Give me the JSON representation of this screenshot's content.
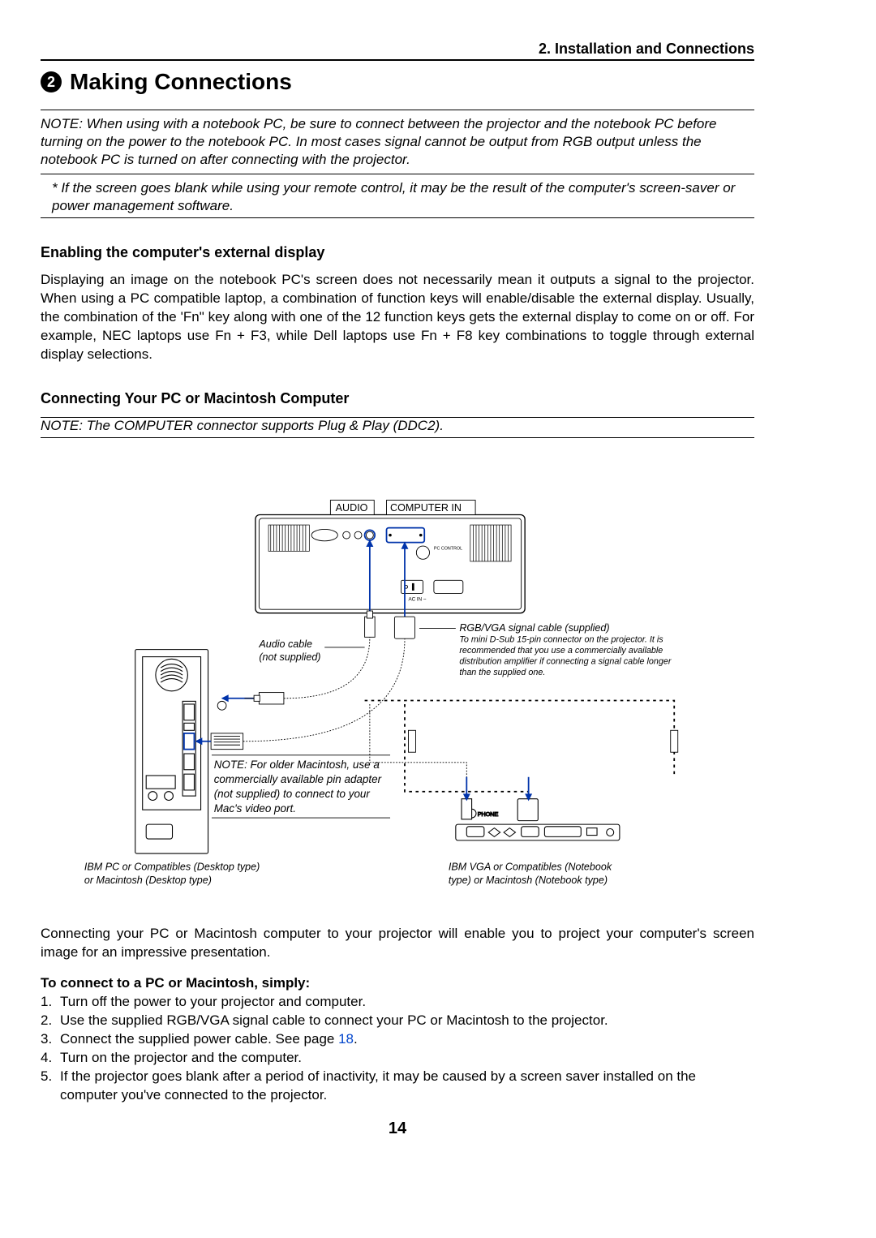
{
  "chapterHeader": "2. Installation and Connections",
  "circleNumber": "2",
  "sectionTitle": "Making Connections",
  "note1": "NOTE: When using with a notebook PC, be sure to connect between the projector and the notebook PC before turning on the power to the notebook PC. In most cases signal cannot be output from RGB output unless the notebook PC is turned on after connecting with the projector.",
  "note2": "*  If the screen goes blank while using your remote control, it may be the result of the computer's screen-saver or power management software.",
  "subHeading1": "Enabling the computer's external display",
  "body1": "Displaying an image on the notebook PC's screen does not necessarily mean it outputs a signal to the projector. When using a PC compatible laptop, a combination of function keys will enable/disable the external display. Usually, the combination of the 'Fn\" key along with one of the 12 function keys gets the external display to come on or off. For example, NEC laptops use Fn + F3, while Dell laptops use Fn + F8 key combinations to toggle through external display selections.",
  "subHeading2": "Connecting Your PC or Macintosh Computer",
  "subNote2": "NOTE: The COMPUTER connector supports Plug & Play (DDC2).",
  "diagram": {
    "labelAudio": "AUDIO",
    "labelComputerIn": "COMPUTER IN",
    "labelAudioCable1": "Audio cable",
    "labelAudioCable2": "(not supplied)",
    "labelRgbTitle": "RGB/VGA signal cable (supplied)",
    "labelRgbBody": "To mini D-Sub 15-pin connector on the projector. It is recommended that you use a commercially available distribution amplifier if connecting a signal cable longer than the supplied one.",
    "macNoteL1": "NOTE: For older Macintosh, use a",
    "macNoteL2": "commercially available pin adapter",
    "macNoteL3": "(not supplied) to connect to your",
    "macNoteL4": "Mac's video port.",
    "leftCaption1": "IBM PC or Compatibles (Desktop type)",
    "leftCaption2": "or Macintosh (Desktop type)",
    "rightCaption1": "IBM VGA or Compatibles (Notebook",
    "rightCaption2": "type) or Macintosh (Notebook type)",
    "phone": "PHONE",
    "acin": "AC IN ~"
  },
  "connText": "Connecting your PC or Macintosh computer to your projector will enable you to project your computer's screen image for an impressive presentation.",
  "stepsHeading": "To connect to a PC or Macintosh, simply:",
  "steps": {
    "s1": "Turn off the power to your projector and computer.",
    "s2": "Use the supplied RGB/VGA signal cable to connect your PC or Macintosh to the projector.",
    "s3a": "Connect the supplied power cable. See page ",
    "s3link": "18",
    "s3b": ".",
    "s4": "Turn on the projector and the computer.",
    "s5": "If the projector goes blank after a period of inactivity, it may be caused by a screen saver installed on the computer you've connected to the projector."
  },
  "pageNumber": "14"
}
